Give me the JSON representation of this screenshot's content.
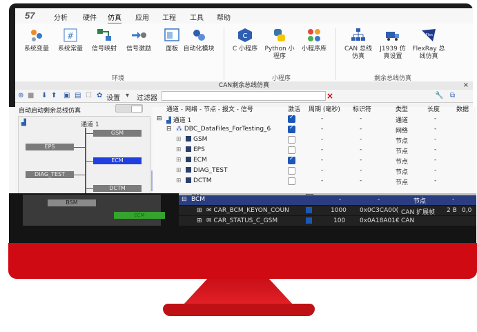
{
  "menubar": {
    "logo": "57",
    "items": [
      "分析",
      "硬件",
      "仿真",
      "应用",
      "工程",
      "工具",
      "帮助"
    ],
    "active_index": 2
  },
  "ribbon": {
    "buttons": [
      "系统变量",
      "系统常量",
      "信号映射",
      "信号激励",
      "面板",
      "自动化模块",
      "C 小程序",
      "Python 小程序",
      "小程序库",
      "CAN 总线仿真",
      "J1939 仿真设置",
      "FlexRay 总线仿真"
    ],
    "groups": [
      "环境",
      "小程序",
      "剩余总线仿真"
    ]
  },
  "subwindow": {
    "title": "CAN剩余总线仿真",
    "close": "×"
  },
  "toolbar": {
    "settings": "设置",
    "filter_label": "过滤器",
    "filter_value": "",
    "clear": "×"
  },
  "left": {
    "autostart_label": "自动启动剩余总线仿真",
    "channel_label": "通道 1",
    "nodes": [
      "GSM",
      "EPS",
      "ECM",
      "DIAG_TEST",
      "DCTM",
      "BSM",
      "ECM"
    ]
  },
  "table": {
    "headers": [
      "通道 - 网络 - 节点 - 报文 - 信号",
      "激活",
      "周期 (毫秒)",
      "标识符",
      "类型",
      "长度",
      "数据"
    ],
    "rows": [
      {
        "name": "通道 1",
        "active": true,
        "period": "-",
        "id": "-",
        "type": "通道",
        "len": "-"
      },
      {
        "name": "DBC_DataFiles_ForTesting_6",
        "active": true,
        "period": "-",
        "id": "-",
        "type": "网络",
        "len": "-"
      },
      {
        "name": "GSM",
        "active": false,
        "period": "-",
        "id": "-",
        "type": "节点",
        "len": "-"
      },
      {
        "name": "EPS",
        "active": false,
        "period": "-",
        "id": "-",
        "type": "节点",
        "len": "-"
      },
      {
        "name": "ECM",
        "active": true,
        "period": "-",
        "id": "-",
        "type": "节点",
        "len": "-"
      },
      {
        "name": "DIAG_TEST",
        "active": false,
        "period": "-",
        "id": "-",
        "type": "节点",
        "len": "-"
      },
      {
        "name": "DCTM",
        "active": false,
        "period": "-",
        "id": "-",
        "type": "节点",
        "len": "-"
      }
    ]
  },
  "band": {
    "gray_row": {
      "name": "SM",
      "period": "-",
      "id": "-",
      "type": "节点",
      "len": "-"
    },
    "bcm_row": {
      "name": "BCM",
      "period": "-",
      "id": "-",
      "type": "节点",
      "len": "-"
    },
    "msg_rows": [
      {
        "name": "CAR_BCM_KEYON_COUN",
        "period": "1000",
        "id": "0x0C3CA00(",
        "type": "CAN 扩展帧",
        "len": "2 B",
        "data": "0,0"
      },
      {
        "name": "CAR_STATUS_C_GSM",
        "period": "100",
        "id": "0x0A18A01€",
        "type": "CAN"
      }
    ]
  },
  "colors": {
    "accent_red": "#cf0a12",
    "selected_blue": "#1f3fe0",
    "checkbox_blue": "#1c57b8",
    "node_green": "#35a32e"
  }
}
